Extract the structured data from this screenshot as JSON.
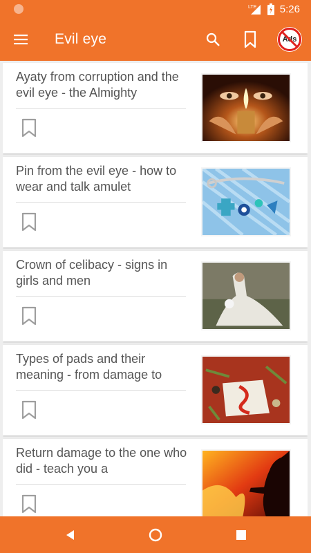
{
  "status_bar": {
    "time": "5:26",
    "network": "LTE"
  },
  "app_bar": {
    "title": "Evil eye",
    "icons": [
      "menu-icon",
      "search-icon",
      "bookmark-icon",
      "no-ads-icon"
    ],
    "no_ads_label": "Ads"
  },
  "articles": [
    {
      "title": "Ayaty from corruption and the evil eye - the Almighty",
      "image": "candle-eyes"
    },
    {
      "title": "Pin from the evil eye - how to wear and talk amulet",
      "image": "pin-amulet"
    },
    {
      "title": "Crown of celibacy - signs in girls and men",
      "image": "bride-veil"
    },
    {
      "title": "Types of pads and their meaning - from damage to",
      "image": "ritual-items"
    },
    {
      "title": "Return damage to the one who did - teach you a",
      "image": "fire-silhouette"
    }
  ],
  "nav_bar": {
    "icons": [
      "back-icon",
      "home-icon",
      "recent-apps-icon"
    ]
  },
  "colors": {
    "accent": "#f0732a",
    "background": "#eeeeee",
    "card": "#ffffff",
    "text": "#555555"
  }
}
